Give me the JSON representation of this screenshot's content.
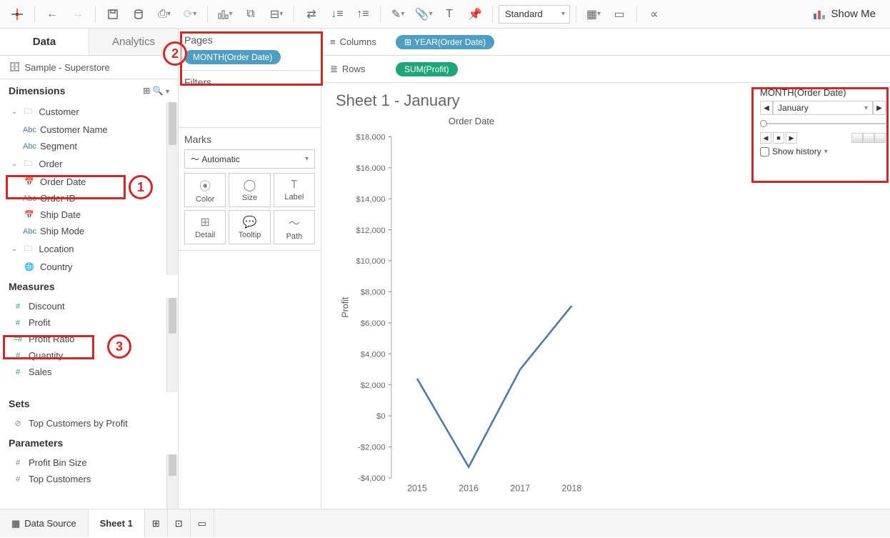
{
  "toolbar": {
    "fit_select": "Standard",
    "showme_label": "Show Me"
  },
  "side": {
    "tabs": {
      "data": "Data",
      "analytics": "Analytics"
    },
    "datasource": "Sample - Superstore",
    "dimensions_hdr": "Dimensions",
    "dims": {
      "customer": "Customer",
      "customer_name": "Customer Name",
      "segment": "Segment",
      "order": "Order",
      "order_date": "Order Date",
      "order_id": "Order ID",
      "ship_date": "Ship Date",
      "ship_mode": "Ship Mode",
      "location": "Location",
      "country": "Country"
    },
    "measures_hdr": "Measures",
    "meas": {
      "discount": "Discount",
      "profit": "Profit",
      "profit_ratio": "Profit Ratio",
      "quantity": "Quantity",
      "sales": "Sales"
    },
    "sets_hdr": "Sets",
    "sets": {
      "top_cust": "Top Customers by Profit"
    },
    "params_hdr": "Parameters",
    "params": {
      "profit_bin": "Profit Bin Size",
      "top_cust": "Top Customers"
    }
  },
  "shelves": {
    "pages_title": "Pages",
    "pages_pill": "MONTH(Order Date)",
    "filters_title": "Filters",
    "marks_title": "Marks",
    "marks_type": "Automatic",
    "marks": {
      "color": "Color",
      "size": "Size",
      "label": "Label",
      "detail": "Detail",
      "tooltip": "Tooltip",
      "path": "Path"
    }
  },
  "colrow": {
    "columns_label": "Columns",
    "columns_pill": "YEAR(Order Date)",
    "rows_label": "Rows",
    "rows_pill": "SUM(Profit)"
  },
  "viz": {
    "sheet_title": "Sheet 1 - January",
    "axis_title": "Order Date",
    "y_axis": "Profit"
  },
  "page_ctrl": {
    "title": "MONTH(Order Date)",
    "current": "January",
    "show_history": "Show history"
  },
  "bottom": {
    "datasource": "Data Source",
    "sheet1": "Sheet 1"
  },
  "annotations": {
    "a1": "1",
    "a2": "2",
    "a3": "3"
  },
  "chart_data": {
    "type": "line",
    "title": "Order Date",
    "xlabel": "",
    "ylabel": "Profit",
    "categories": [
      "2015",
      "2016",
      "2017",
      "2018"
    ],
    "values": [
      2400,
      -3300,
      3000,
      7100
    ],
    "ylim": [
      -4000,
      18000
    ],
    "yticks": [
      -4000,
      -2000,
      0,
      2000,
      4000,
      6000,
      8000,
      10000,
      12000,
      14000,
      16000,
      18000
    ],
    "ytick_labels": [
      "-$4,000",
      "-$2,000",
      "$0",
      "$2,000",
      "$4,000",
      "$6,000",
      "$8,000",
      "$10,000",
      "$12,000",
      "$14,000",
      "$16,000",
      "$18,000"
    ]
  }
}
